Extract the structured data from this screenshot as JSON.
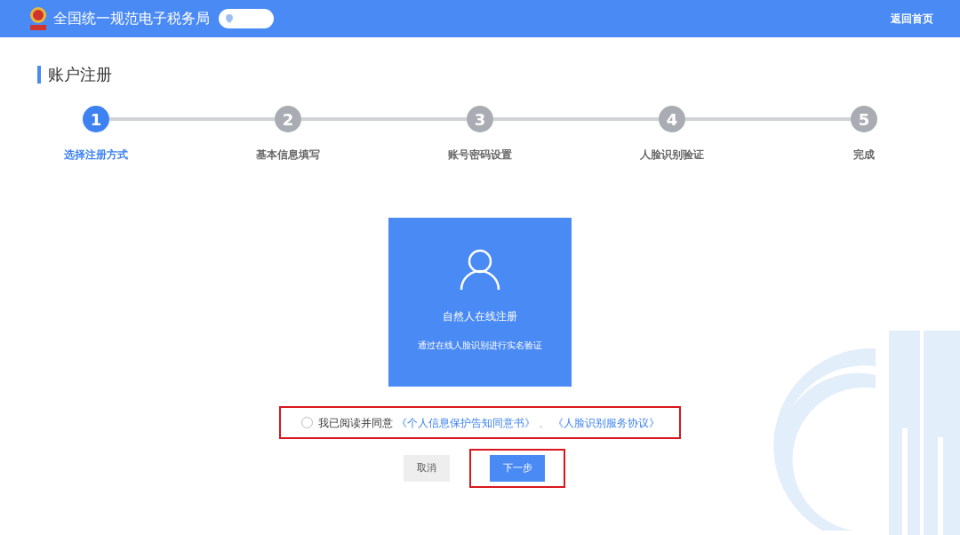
{
  "header": {
    "title": "全国统一规范电子税务局",
    "home_link": "返回首页"
  },
  "page_title": "账户注册",
  "steps": [
    {
      "number": "1",
      "label": "选择注册方式",
      "selected": true
    },
    {
      "number": "2",
      "label": "基本信息填写",
      "selected": false
    },
    {
      "number": "3",
      "label": "账号密码设置",
      "selected": false
    },
    {
      "number": "4",
      "label": "人脸识别验证",
      "selected": false
    },
    {
      "number": "5",
      "label": "完成",
      "selected": false
    }
  ],
  "option_card": {
    "title": "自然人在线注册",
    "description": "通过在线人脸识别进行实名验证"
  },
  "agreement": {
    "checked": false,
    "highlighted": true,
    "text": "我已阅读并同意",
    "links": [
      "《个人信息保护告知同意书》",
      "《人脸识别服务协议》"
    ],
    "separator": "、"
  },
  "buttons": [
    {
      "label": "取消",
      "kind": "secondary",
      "highlighted": false
    },
    {
      "label": "下一步",
      "kind": "primary",
      "highlighted": true
    }
  ]
}
